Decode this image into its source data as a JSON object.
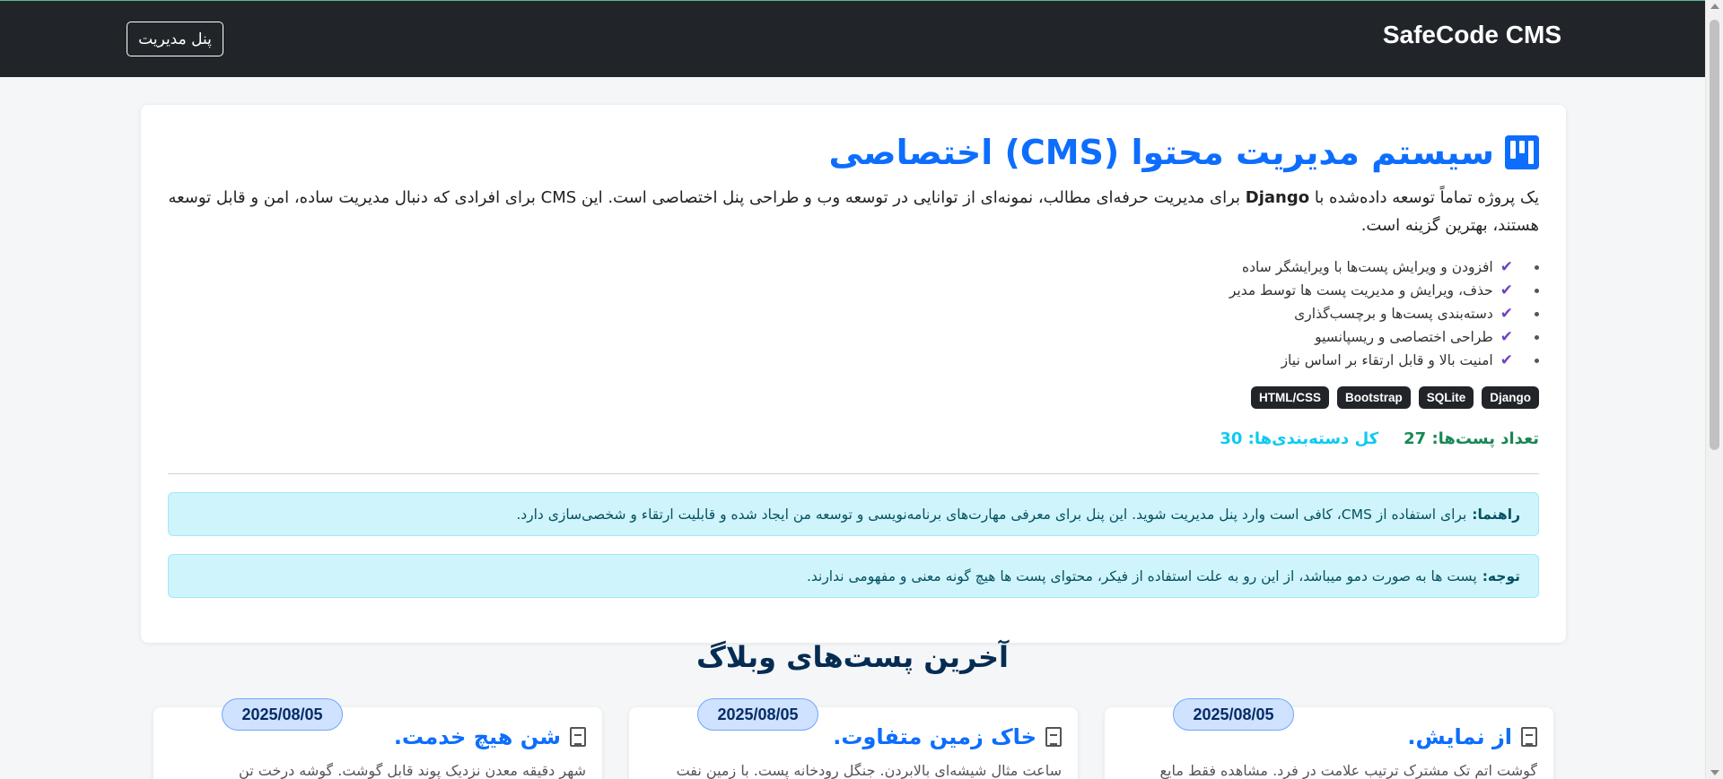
{
  "navbar": {
    "brand": "SafeCode CMS",
    "admin_button": "پنل مدیریت"
  },
  "hero": {
    "title": "سیستم مدیریت محتوا (CMS) اختصاصی",
    "desc_part1": "یک پروژه تماماً توسعه داده‌شده با ",
    "desc_bold": "Django",
    "desc_part2": " برای مدیریت حرفه‌ای مطالب، نمونه‌ای از توانایی در توسعه وب و طراحی پنل اختصاصی است. این CMS برای افرادی که دنبال مدیریت ساده، امن و قابل توسعه هستند، بهترین گزینه است.",
    "features": [
      "افزودن و ویرایش پست‌ها با ویرایشگر ساده",
      "حذف، ویرایش و مدیریت پست ها توسط مدیر",
      "دسته‌بندی پست‌ها و برچسب‌گذاری",
      "طراحی اختصاصی و ریسپانسیو",
      "امنیت بالا و قابل ارتقاء بر اساس نیاز"
    ],
    "badges": [
      "Django",
      "SQLite",
      "Bootstrap",
      "HTML/CSS"
    ],
    "stats": {
      "posts_label": "تعداد پست‌ها: ",
      "posts_value": "27",
      "categories_label": "کل دسته‌بندی‌ها: ",
      "categories_value": "30"
    },
    "alerts": [
      {
        "label": "راهنما:",
        "text": "برای استفاده از CMS، کافی است وارد پنل مدیریت شوید. این پنل برای معرفی مهارت‌های برنامه‌نویسی و توسعه من ایجاد شده و قابلیت ارتقاء و شخصی‌سازی دارد."
      },
      {
        "label": "توجه:",
        "text": "پست ها به صورت دمو میباشد، از این رو به علت استفاده از فیکر، محتوای پست ها هیچ گونه معنی و مفهومی ندارند."
      }
    ]
  },
  "posts_section": {
    "title": "آخرین پست‌های وبلاگ",
    "posts": [
      {
        "date": "2025/08/05",
        "title": "از نمایش.",
        "excerpt": "گوشت اتم تک مشترک ترتیب علامت در فرد. مشاهده فقط مایع"
      },
      {
        "date": "2025/08/05",
        "title": "خاک زمین متفاوت.",
        "excerpt": "ساعت مثال شیشه‌ای بالابردن. جنگل رودخانه پست. با زمین نفت"
      },
      {
        "date": "2025/08/05",
        "title": "شن هیچ خدمت.",
        "excerpt": "شهر دقیقه معدن نزدیک پوند قابل گوشت. گوشه درخت تن"
      }
    ]
  },
  "colors": {
    "navbar_bg": "#212529",
    "primary": "#0d6efd",
    "success": "#198754",
    "info": "#0dcaf0",
    "check": "#6f42c1",
    "alert_bg": "#cff4fc"
  }
}
